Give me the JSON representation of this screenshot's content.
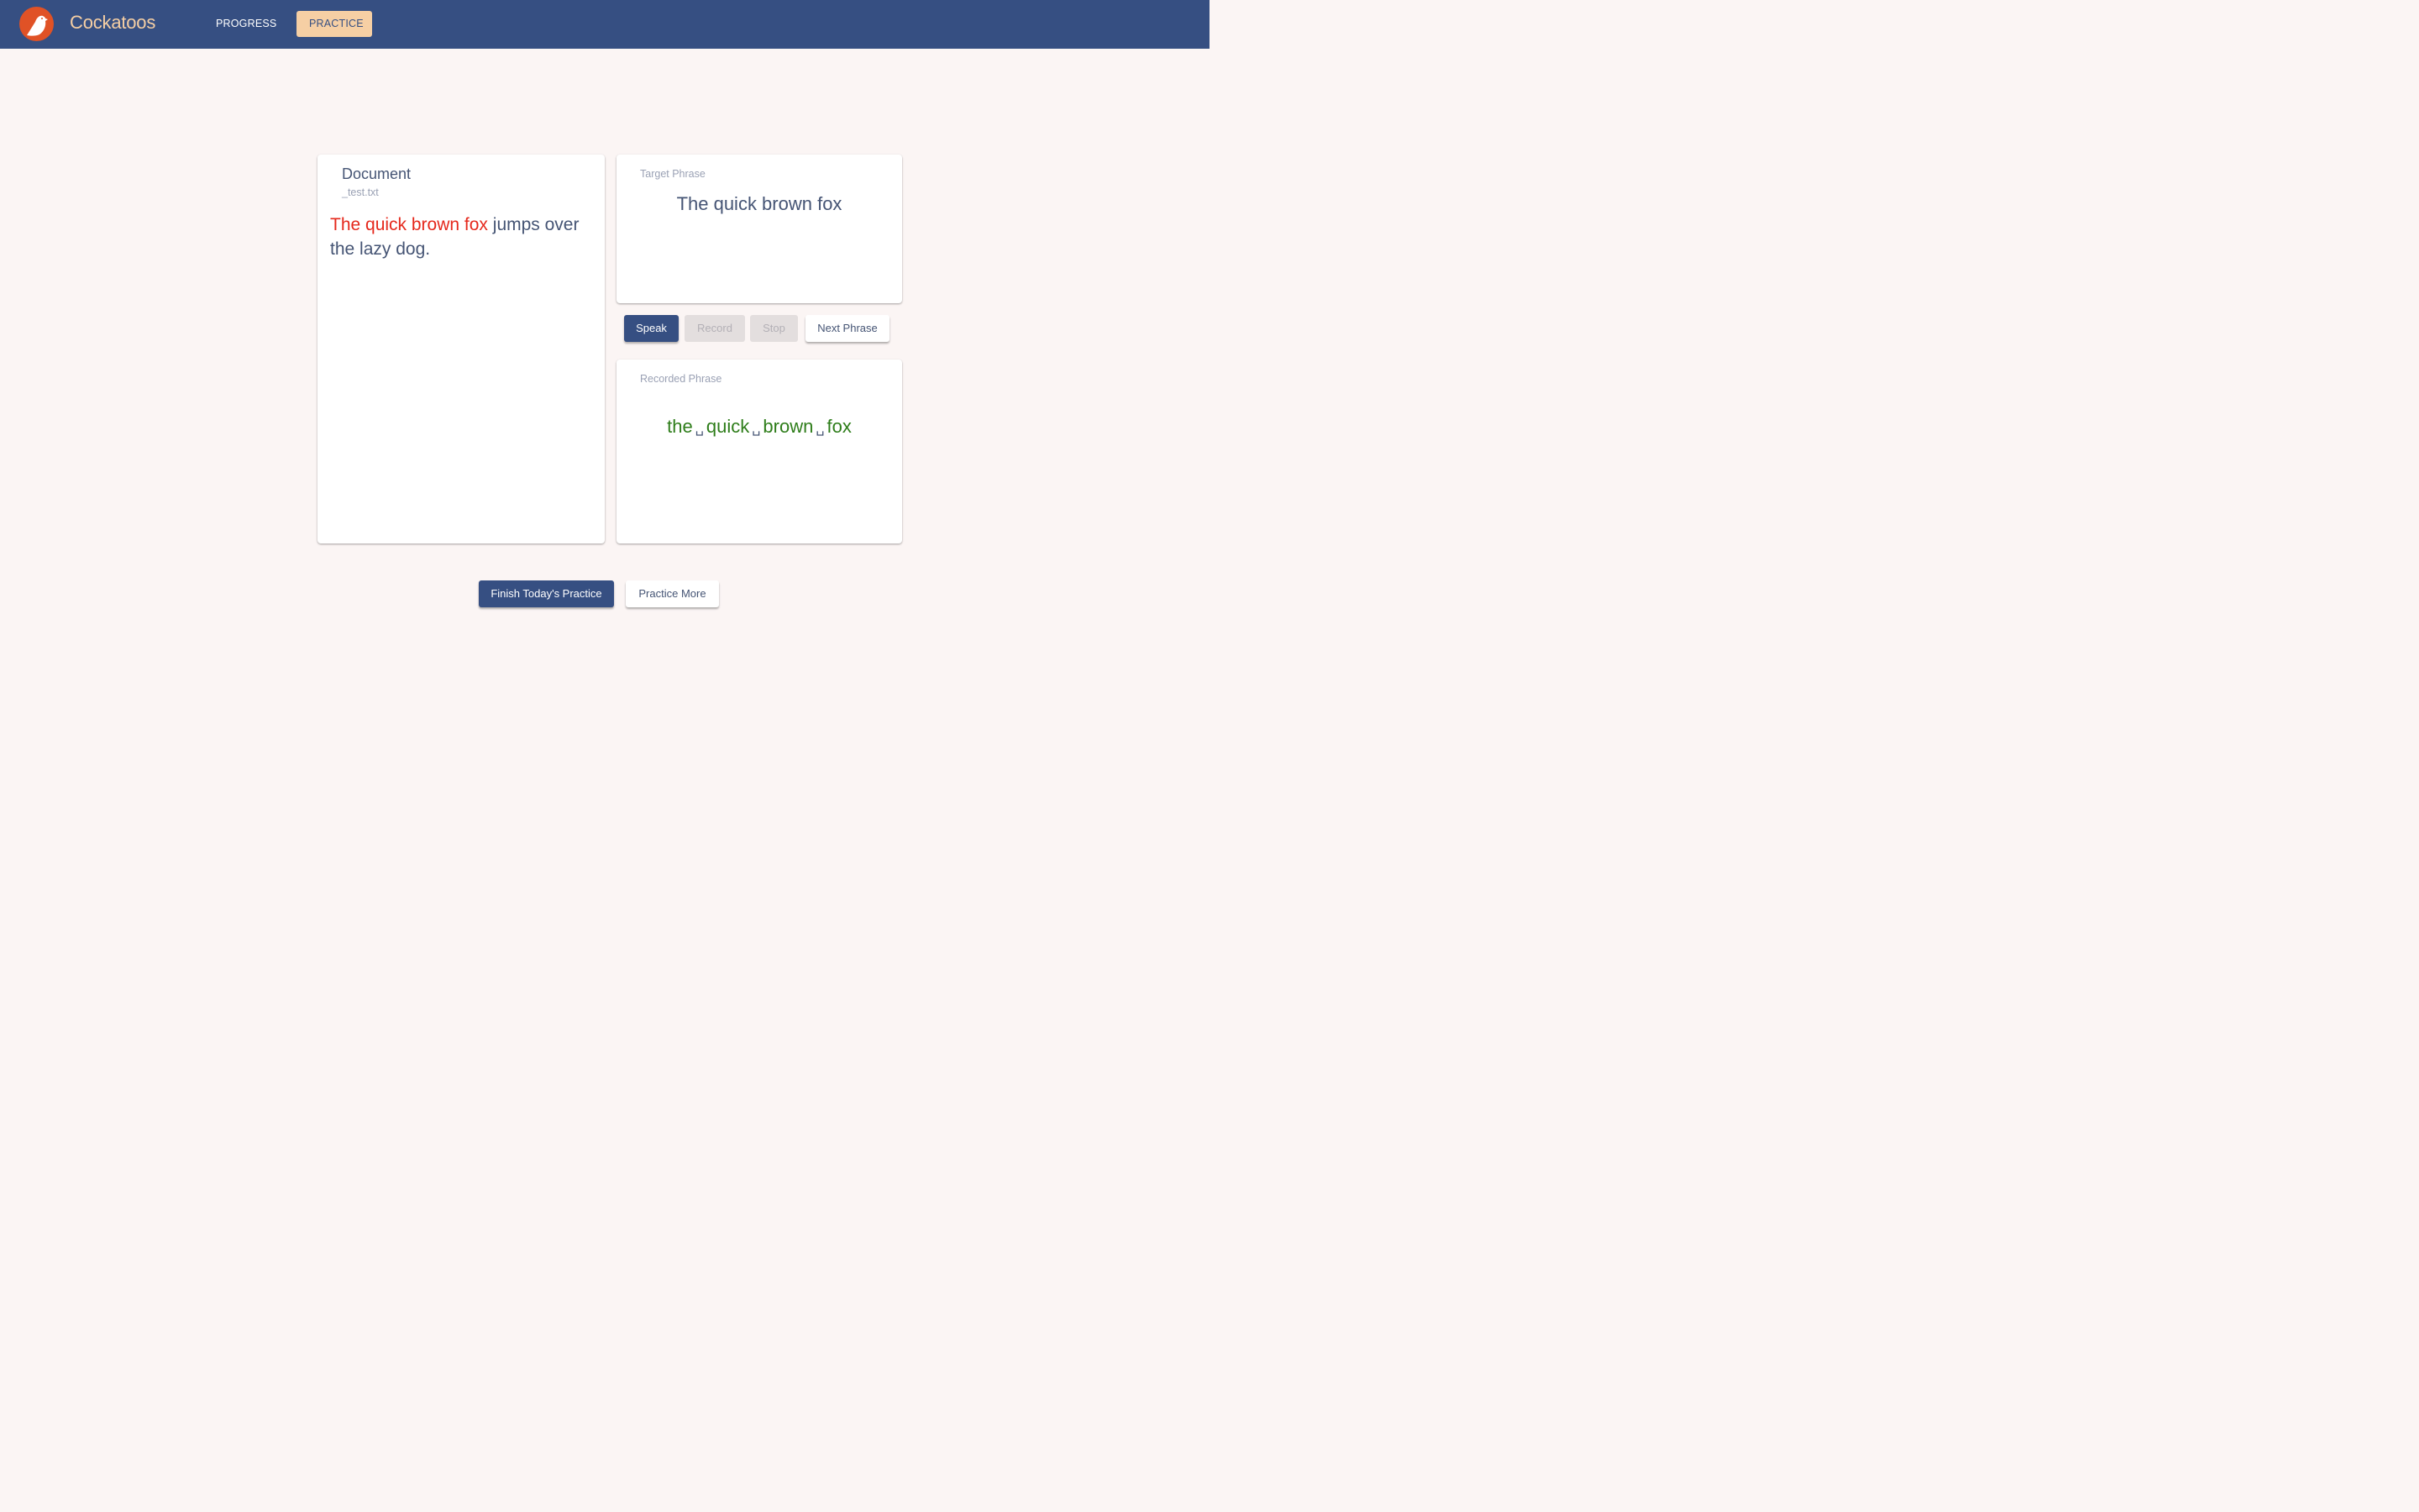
{
  "header": {
    "brand": "Cockatoos",
    "logo_icon": "cockatoo-bird-icon",
    "nav": [
      {
        "label": "PROGRESS",
        "active": false
      },
      {
        "label": "PRACTICE",
        "active": true
      }
    ]
  },
  "document": {
    "title": "Document",
    "filename": "_test.txt",
    "highlighted_text": "The quick brown fox",
    "remaining_text": " jumps over the lazy dog."
  },
  "target": {
    "label": "Target Phrase",
    "phrase": "The quick brown fox"
  },
  "controls": {
    "speak": "Speak",
    "record": "Record",
    "stop": "Stop",
    "next": "Next Phrase"
  },
  "recorded": {
    "label": "Recorded Phrase",
    "words": [
      "the",
      "quick",
      "brown",
      "fox"
    ],
    "space_symbol": "␣"
  },
  "footer": {
    "finish": "Finish Today's Practice",
    "more": "Practice More"
  },
  "colors": {
    "header_bg": "#364f82",
    "accent": "#f6cfa4",
    "logo_bg": "#e05226",
    "highlight": "#e5281c",
    "match": "#2e7d1a",
    "text": "#455474"
  }
}
